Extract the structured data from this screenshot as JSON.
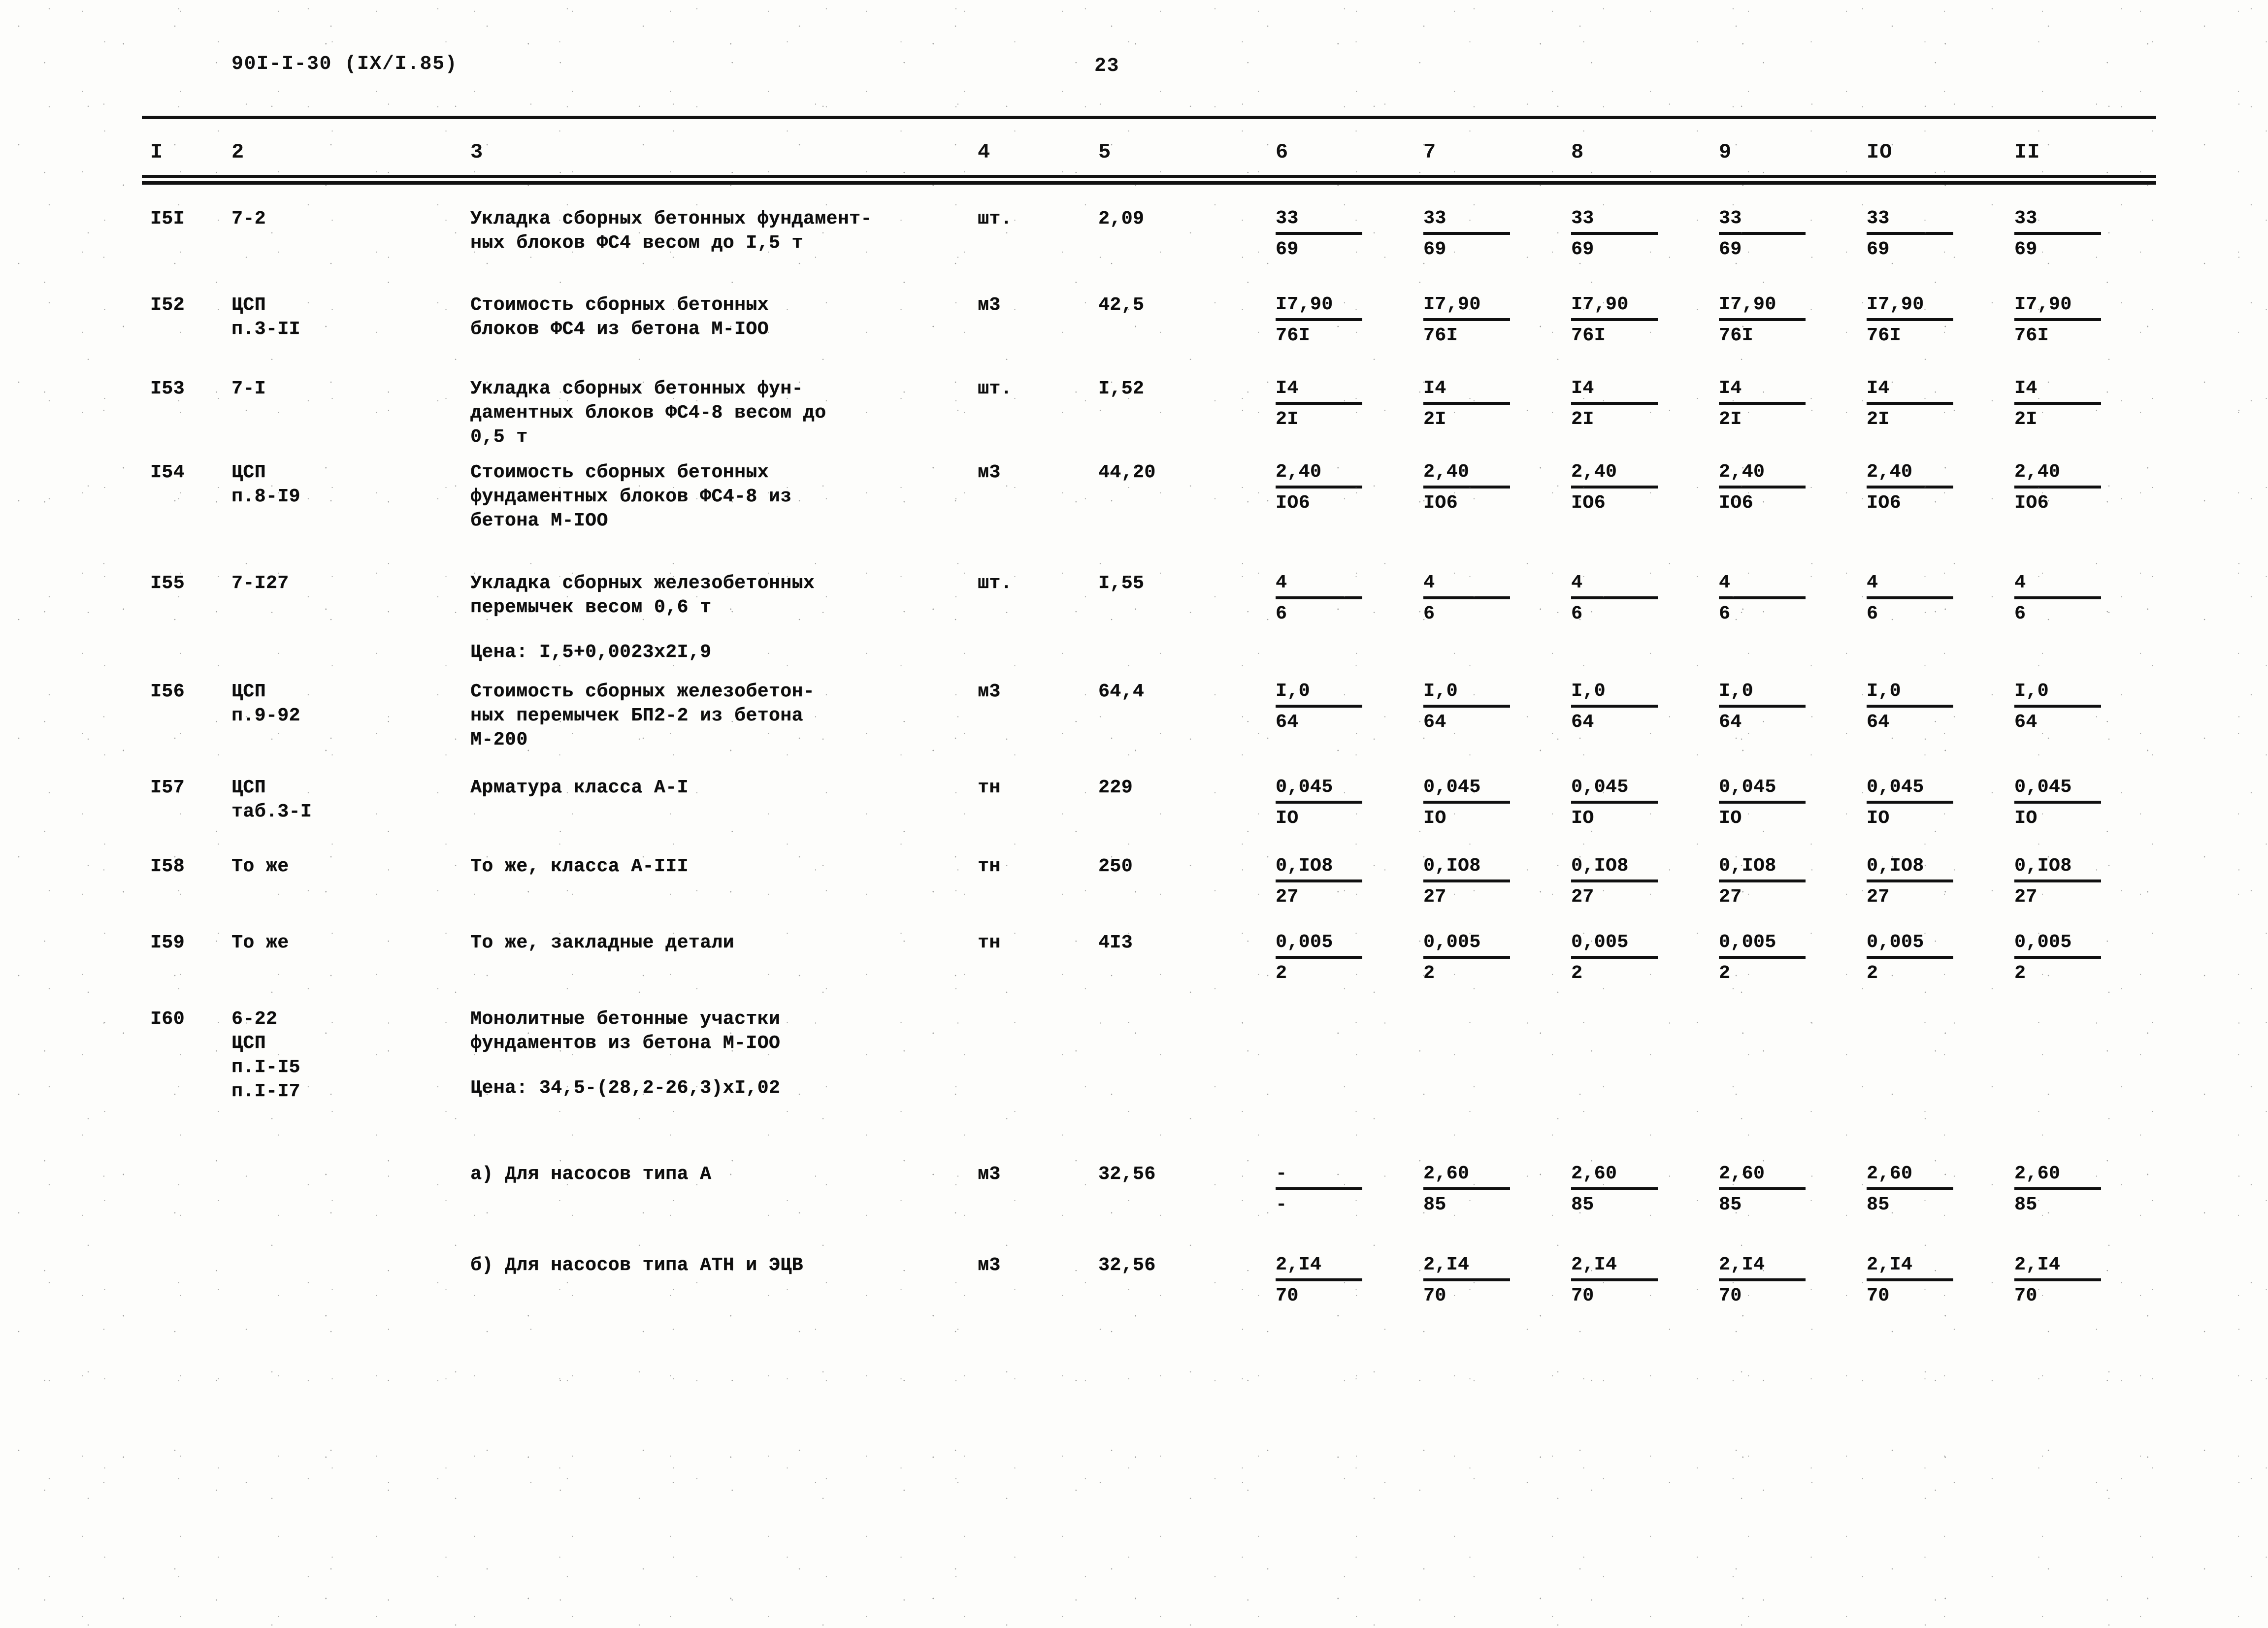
{
  "header": {
    "doc_code": "90I-I-30 (IX/I.85)",
    "page_number": "23"
  },
  "table": {
    "column_headers": [
      "I",
      "2",
      "3",
      "4",
      "5",
      "6",
      "7",
      "8",
      "9",
      "IO",
      "II"
    ],
    "rows": [
      {
        "num": "I5I",
        "code": "7-2",
        "desc": "Укладка сборных бетонных фундамент-\nных блоков ФС4 весом до I,5 т",
        "unit": "шт.",
        "qty": "2,09",
        "values": [
          {
            "num": "33",
            "den": "69"
          },
          {
            "num": "33",
            "den": "69"
          },
          {
            "num": "33",
            "den": "69"
          },
          {
            "num": "33",
            "den": "69"
          },
          {
            "num": "33",
            "den": "69"
          },
          {
            "num": "33",
            "den": "69"
          }
        ]
      },
      {
        "num": "I52",
        "code": "ЦСП\nп.3-II",
        "desc": "Стоимость сборных бетонных\nблоков ФС4 из бетона М-IОО",
        "unit": "м3",
        "qty": "42,5",
        "values": [
          {
            "num": "I7,90",
            "den": "76I"
          },
          {
            "num": "I7,90",
            "den": "76I"
          },
          {
            "num": "I7,90",
            "den": "76I"
          },
          {
            "num": "I7,90",
            "den": "76I"
          },
          {
            "num": "I7,90",
            "den": "76I"
          },
          {
            "num": "I7,90",
            "den": "76I"
          }
        ]
      },
      {
        "num": "I53",
        "code": "7-I",
        "desc": "Укладка сборных бетонных фун-\nдаментных блоков ФС4-8 весом до\n0,5 т",
        "unit": "шт.",
        "qty": "I,52",
        "values": [
          {
            "num": "I4",
            "den": "2I"
          },
          {
            "num": "I4",
            "den": "2I"
          },
          {
            "num": "I4",
            "den": "2I"
          },
          {
            "num": "I4",
            "den": "2I"
          },
          {
            "num": "I4",
            "den": "2I"
          },
          {
            "num": "I4",
            "den": "2I"
          }
        ]
      },
      {
        "num": "I54",
        "code": "ЦСП\nп.8-I9",
        "desc": "Стоимость сборных бетонных\nфундаментных блоков ФС4-8 из\nбетона М-IОО",
        "unit": "м3",
        "qty": "44,20",
        "values": [
          {
            "num": "2,40",
            "den": "IО6"
          },
          {
            "num": "2,40",
            "den": "IО6"
          },
          {
            "num": "2,40",
            "den": "IО6"
          },
          {
            "num": "2,40",
            "den": "IО6"
          },
          {
            "num": "2,40",
            "den": "IО6"
          },
          {
            "num": "2,40",
            "den": "IО6"
          }
        ]
      },
      {
        "num": "I55",
        "code": "7-I27",
        "desc": "Укладка сборных железобетонных\nперемычек весом 0,6 т",
        "note": "Цена: I,5+0,0023x2I,9",
        "unit": "шт.",
        "qty": "I,55",
        "values": [
          {
            "num": "4",
            "den": "6"
          },
          {
            "num": "4",
            "den": "6"
          },
          {
            "num": "4",
            "den": "6"
          },
          {
            "num": "4",
            "den": "6"
          },
          {
            "num": "4",
            "den": "6"
          },
          {
            "num": "4",
            "den": "6"
          }
        ]
      },
      {
        "num": "I56",
        "code": "ЦСП\nп.9-92",
        "desc": "Стоимость сборных железобетон-\nных перемычек БП2-2 из бетона\nМ-200",
        "unit": "м3",
        "qty": "64,4",
        "values": [
          {
            "num": "I,0",
            "den": "64"
          },
          {
            "num": "I,0",
            "den": "64"
          },
          {
            "num": "I,0",
            "den": "64"
          },
          {
            "num": "I,0",
            "den": "64"
          },
          {
            "num": "I,0",
            "den": "64"
          },
          {
            "num": "I,0",
            "den": "64"
          }
        ]
      },
      {
        "num": "I57",
        "code": "ЦСП\nтаб.3-I",
        "desc": "Арматура класса А-I",
        "unit": "тн",
        "qty": "229",
        "values": [
          {
            "num": "0,045",
            "den": "IО"
          },
          {
            "num": "0,045",
            "den": "IО"
          },
          {
            "num": "0,045",
            "den": "IО"
          },
          {
            "num": "0,045",
            "den": "IО"
          },
          {
            "num": "0,045",
            "den": "IО"
          },
          {
            "num": "0,045",
            "den": "IО"
          }
        ]
      },
      {
        "num": "I58",
        "code": "То же",
        "desc": "То же, класса А-III",
        "unit": "тн",
        "qty": "250",
        "values": [
          {
            "num": "0,IО8",
            "den": "27"
          },
          {
            "num": "0,IО8",
            "den": "27"
          },
          {
            "num": "0,IО8",
            "den": "27"
          },
          {
            "num": "0,IО8",
            "den": "27"
          },
          {
            "num": "0,IО8",
            "den": "27"
          },
          {
            "num": "0,IО8",
            "den": "27"
          }
        ]
      },
      {
        "num": "I59",
        "code": "То же",
        "desc": "То же, закладные детали",
        "unit": "тн",
        "qty": "4I3",
        "values": [
          {
            "num": "0,005",
            "den": "2"
          },
          {
            "num": "0,005",
            "den": "2"
          },
          {
            "num": "0,005",
            "den": "2"
          },
          {
            "num": "0,005",
            "den": "2"
          },
          {
            "num": "0,005",
            "den": "2"
          },
          {
            "num": "0,005",
            "den": "2"
          }
        ]
      },
      {
        "num": "I60",
        "code": "6-22\nЦСП\nп.I-I5\nп.I-I7",
        "desc": "Монолитные бетонные участки\nфундаментов из бетона М-IОО",
        "note": "Цена: 34,5-(28,2-26,3)xI,02",
        "unit": "",
        "qty": "",
        "values": []
      },
      {
        "num": "",
        "code": "",
        "desc": "а) Для насосов типа А",
        "unit": "м3",
        "qty": "32,56",
        "values": [
          {
            "num": "-",
            "den": "-"
          },
          {
            "num": "2,60",
            "den": "85"
          },
          {
            "num": "2,60",
            "den": "85"
          },
          {
            "num": "2,60",
            "den": "85"
          },
          {
            "num": "2,60",
            "den": "85"
          },
          {
            "num": "2,60",
            "den": "85"
          }
        ]
      },
      {
        "num": "",
        "code": "",
        "desc": "б) Для насосов типа АТН и ЭЦВ",
        "unit": "м3",
        "qty": "32,56",
        "values": [
          {
            "num": "2,I4",
            "den": "70"
          },
          {
            "num": "2,I4",
            "den": "70"
          },
          {
            "num": "2,I4",
            "den": "70"
          },
          {
            "num": "2,I4",
            "den": "70"
          },
          {
            "num": "2,I4",
            "den": "70"
          },
          {
            "num": "2,I4",
            "den": "70"
          }
        ]
      }
    ]
  }
}
